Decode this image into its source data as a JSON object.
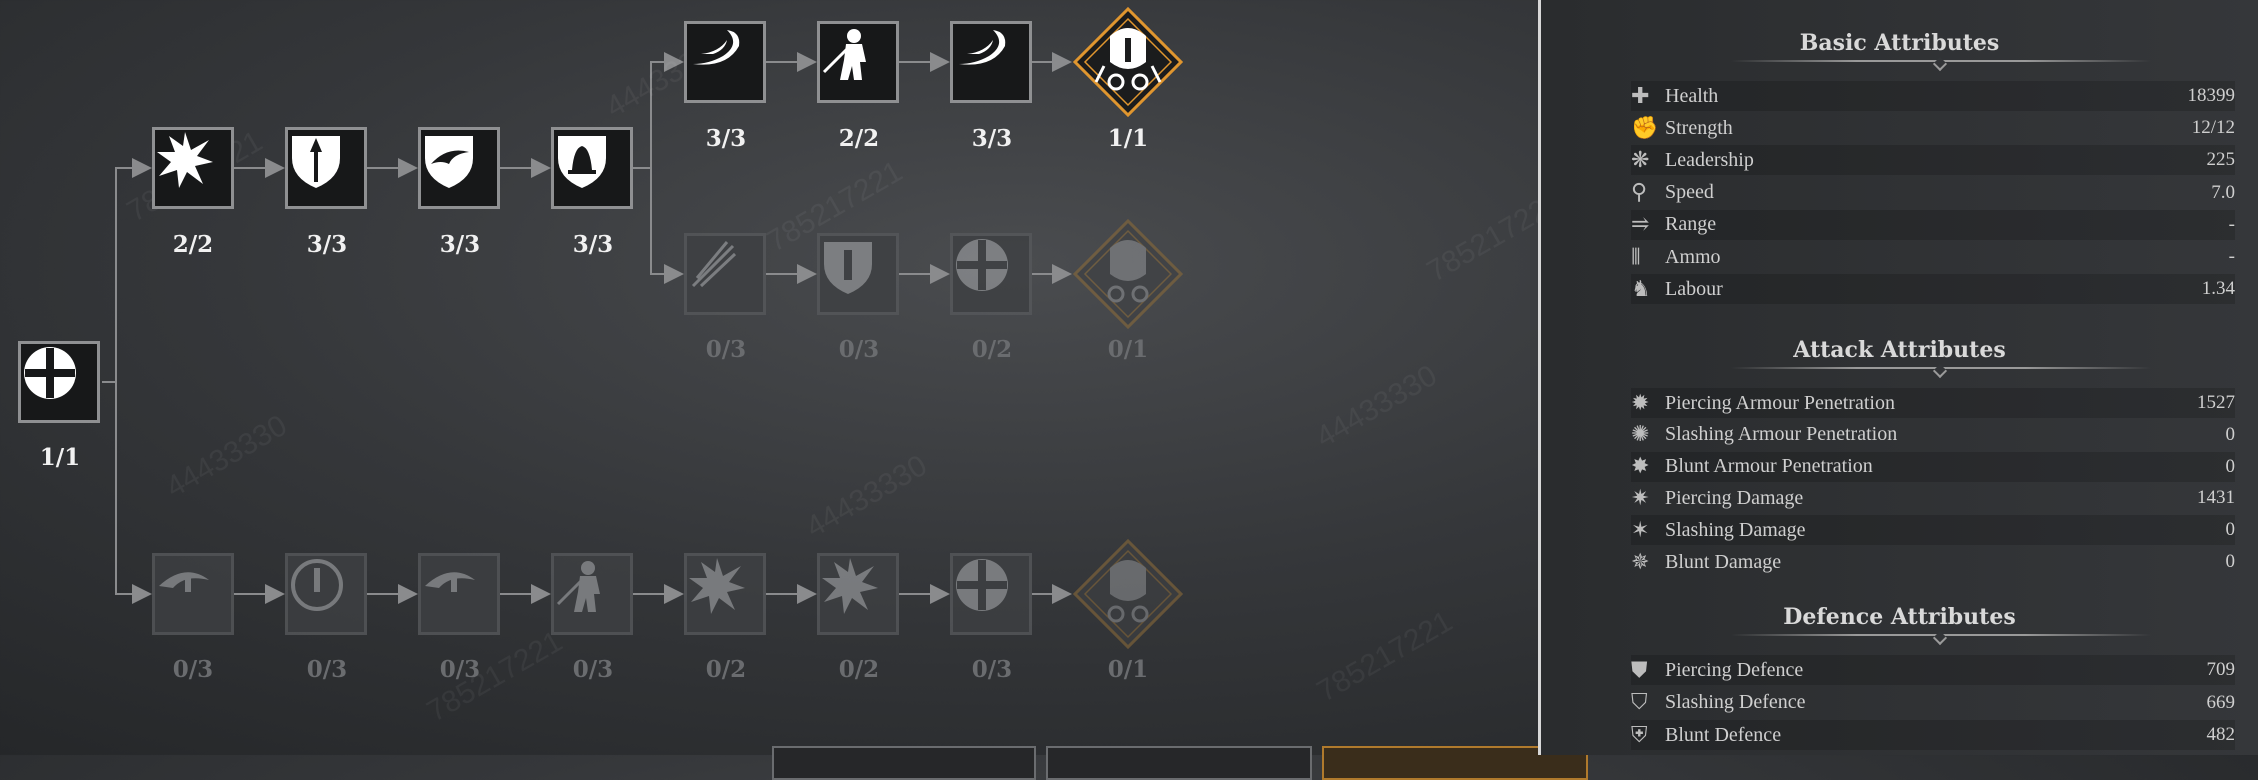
{
  "tree": {
    "root": {
      "icon": "cross-icon",
      "count": "1/1"
    },
    "branch_a": [
      {
        "icon": "burst-icon",
        "count": "2/2"
      },
      {
        "icon": "spear-shield-icon",
        "count": "3/3"
      },
      {
        "icon": "wing-shield-icon",
        "count": "3/3"
      },
      {
        "icon": "bell-shield-icon",
        "count": "3/3"
      }
    ],
    "branch_a_top": [
      {
        "icon": "slash-swirl-icon",
        "count": "3/3"
      },
      {
        "icon": "warrior-icon",
        "count": "2/2"
      },
      {
        "icon": "slash-swirl-icon",
        "count": "3/3"
      },
      {
        "icon": "helmet-crest-icon",
        "count": "1/1"
      }
    ],
    "branch_a_bottom": [
      {
        "icon": "arrows-icon",
        "count": "0/3"
      },
      {
        "icon": "shield-ammo-icon",
        "count": "0/3"
      },
      {
        "icon": "cross-icon",
        "count": "0/2"
      },
      {
        "icon": "helmet-crest-icon",
        "count": "0/1"
      }
    ],
    "branch_b": [
      {
        "icon": "eye-swirl-icon",
        "count": "0/3"
      },
      {
        "icon": "clock-ammo-icon",
        "count": "0/3"
      },
      {
        "icon": "eye-swirl-icon",
        "count": "0/3"
      },
      {
        "icon": "warrior-icon",
        "count": "0/3"
      },
      {
        "icon": "burst-icon",
        "count": "0/2"
      },
      {
        "icon": "burst-icon",
        "count": "0/2"
      },
      {
        "icon": "cross-icon",
        "count": "0/3"
      },
      {
        "icon": "helmet-crest-icon",
        "count": "0/1"
      }
    ]
  },
  "watermarks": [
    "44433330",
    "785217221"
  ],
  "panel": {
    "basic": {
      "title": "Basic Attributes",
      "rows": [
        {
          "icon": "health-cross-icon",
          "name": "Health",
          "value": "18399"
        },
        {
          "icon": "fist-icon",
          "name": "Strength",
          "value": "12/12"
        },
        {
          "icon": "laurel-icon",
          "name": "Leadership",
          "value": "225"
        },
        {
          "icon": "boot-icon",
          "name": "Speed",
          "value": "7.0"
        },
        {
          "icon": "range-icon",
          "name": "Range",
          "value": "-"
        },
        {
          "icon": "ammo-icon",
          "name": "Ammo",
          "value": "-"
        },
        {
          "icon": "horse-icon",
          "name": "Labour",
          "value": "1.34"
        }
      ]
    },
    "attack": {
      "title": "Attack Attributes",
      "rows": [
        {
          "icon": "pierce-pen-icon",
          "name": "Piercing Armour Penetration",
          "value": "1527"
        },
        {
          "icon": "slash-pen-icon",
          "name": "Slashing Armour Penetration",
          "value": "0"
        },
        {
          "icon": "blunt-pen-icon",
          "name": "Blunt Armour Penetration",
          "value": "0"
        },
        {
          "icon": "pierce-dmg-icon",
          "name": "Piercing Damage",
          "value": "1431"
        },
        {
          "icon": "slash-dmg-icon",
          "name": "Slashing Damage",
          "value": "0"
        },
        {
          "icon": "blunt-dmg-icon",
          "name": "Blunt Damage",
          "value": "0"
        }
      ]
    },
    "defence": {
      "title": "Defence Attributes",
      "rows": [
        {
          "icon": "pierce-def-icon",
          "name": "Piercing Defence",
          "value": "709"
        },
        {
          "icon": "slash-def-icon",
          "name": "Slashing Defence",
          "value": "669"
        },
        {
          "icon": "blunt-def-icon",
          "name": "Blunt Defence",
          "value": "482"
        }
      ]
    }
  },
  "colors": {
    "accent_gold": "#e0962f",
    "locked": "#56585b",
    "active_border": "#8f9092"
  }
}
